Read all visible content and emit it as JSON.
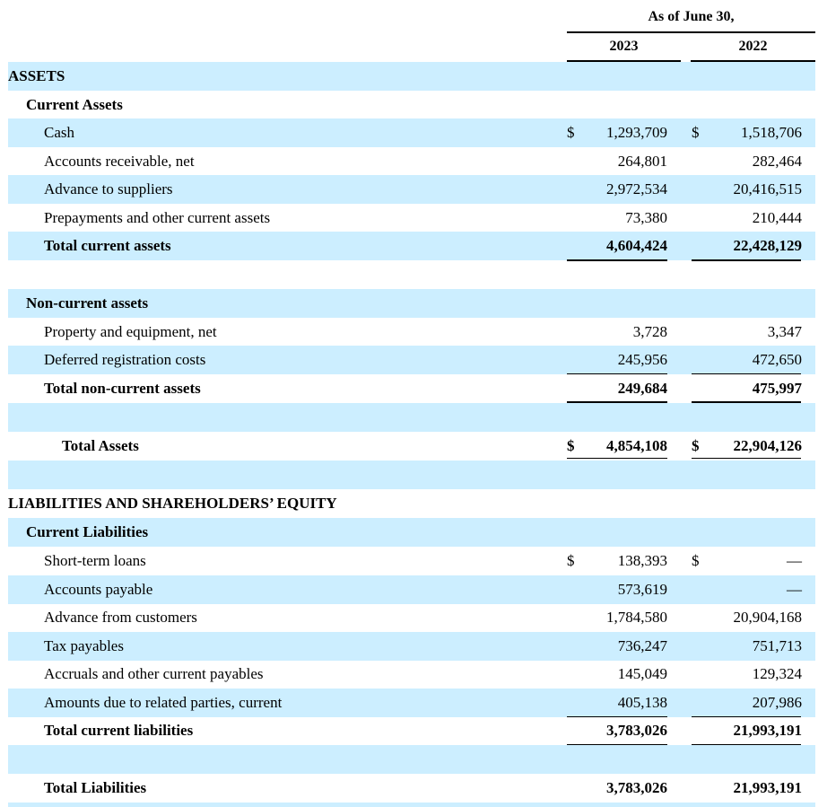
{
  "header": {
    "period": "As of June 30,",
    "col_2023": "2023",
    "col_2022": "2022"
  },
  "rows": [
    {
      "label": "ASSETS"
    },
    {
      "label": "Current Assets"
    },
    {
      "label": "Cash",
      "cur_2023": "$",
      "v2023": "1,293,709",
      "cur_2022": "$",
      "v2022": "1,518,706"
    },
    {
      "label": "Accounts receivable, net",
      "v2023": "264,801",
      "v2022": "282,464"
    },
    {
      "label": "Advance to suppliers",
      "v2023": "2,972,534",
      "v2022": "20,416,515"
    },
    {
      "label": "Prepayments and other current assets",
      "v2023": "73,380",
      "v2022": "210,444"
    },
    {
      "label": "Total current assets",
      "v2023": "4,604,424",
      "v2022": "22,428,129"
    },
    {
      "label": "Non-current assets"
    },
    {
      "label": "Property and equipment, net",
      "v2023": "3,728",
      "v2022": "3,347"
    },
    {
      "label": "Deferred registration costs",
      "v2023": "245,956",
      "v2022": "472,650"
    },
    {
      "label": "Total non-current assets",
      "v2023": "249,684",
      "v2022": "475,997"
    },
    {
      "label": "Total Assets",
      "cur_2023": "$",
      "v2023": "4,854,108",
      "cur_2022": "$",
      "v2022": "22,904,126"
    },
    {
      "label": "LIABILITIES AND SHAREHOLDERS’ EQUITY"
    },
    {
      "label": "Current Liabilities"
    },
    {
      "label": "Short-term loans",
      "cur_2023": "$",
      "v2023": "138,393",
      "cur_2022": "$",
      "v2022": "—"
    },
    {
      "label": "Accounts payable",
      "v2023": "573,619",
      "v2022": "—"
    },
    {
      "label": "Advance from customers",
      "v2023": "1,784,580",
      "v2022": "20,904,168"
    },
    {
      "label": "Tax payables",
      "v2023": "736,247",
      "v2022": "751,713"
    },
    {
      "label": "Accruals and other current payables",
      "v2023": "145,049",
      "v2022": "129,324"
    },
    {
      "label": "Amounts due to related parties, current",
      "v2023": "405,138",
      "v2022": "207,986"
    },
    {
      "label": "Total current liabilities",
      "v2023": "3,783,026",
      "v2022": "21,993,191"
    },
    {
      "label": "Total Liabilities",
      "v2023": "3,783,026",
      "v2022": "21,993,191"
    }
  ]
}
